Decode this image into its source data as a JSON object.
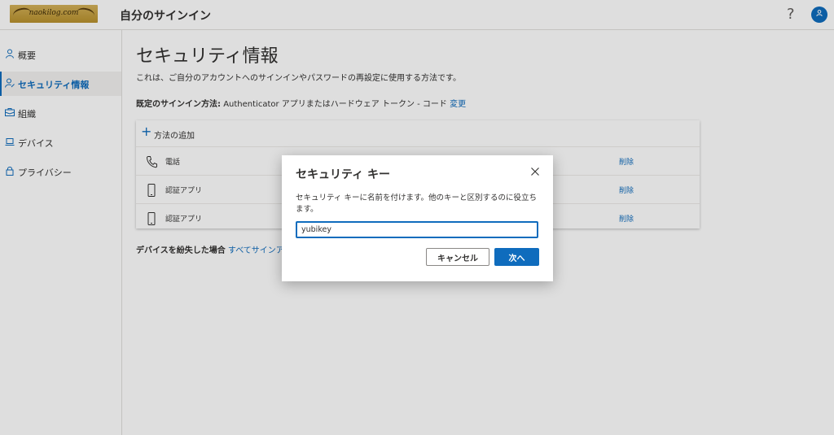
{
  "header": {
    "logo_text": "naokilog.com",
    "title": "自分のサインイン",
    "help": "?"
  },
  "sidebar": {
    "items": [
      {
        "label": "概要",
        "icon": "person-icon"
      },
      {
        "label": "セキュリティ情報",
        "icon": "security-info-icon",
        "active": true
      },
      {
        "label": "組織",
        "icon": "briefcase-icon"
      },
      {
        "label": "デバイス",
        "icon": "laptop-icon"
      },
      {
        "label": "プライバシー",
        "icon": "lock-icon"
      }
    ]
  },
  "main": {
    "title": "セキュリティ情報",
    "description": "これは、ご自分のアカウントへのサインインやパスワードの再設定に使用する方法です。",
    "default_method_label": "既定のサインイン方法:",
    "default_method_value": "Authenticator アプリまたはハードウェア トークン - コード",
    "change_link": "変更",
    "add_method": "方法の追加",
    "methods": [
      {
        "name": "電話",
        "icon": "phone-icon",
        "delete": "削除"
      },
      {
        "name": "認証アプリ",
        "icon": "mobile-device-icon",
        "delete": "削除"
      },
      {
        "name": "認証アプリ",
        "icon": "mobile-device-icon",
        "delete": "削除"
      }
    ],
    "lost_device_label": "デバイスを紛失した場合",
    "lost_device_link": "すべてサインア"
  },
  "dialog": {
    "title": "セキュリティ キー",
    "text": "セキュリティ キーに名前を付けます。他のキーと区別するのに役立ちます。",
    "input_value": "yubikey",
    "cancel_label": "キャンセル",
    "next_label": "次へ"
  },
  "colors": {
    "accent": "#0f6cbd",
    "overlay": "rgba(0,0,0,0.13)"
  }
}
